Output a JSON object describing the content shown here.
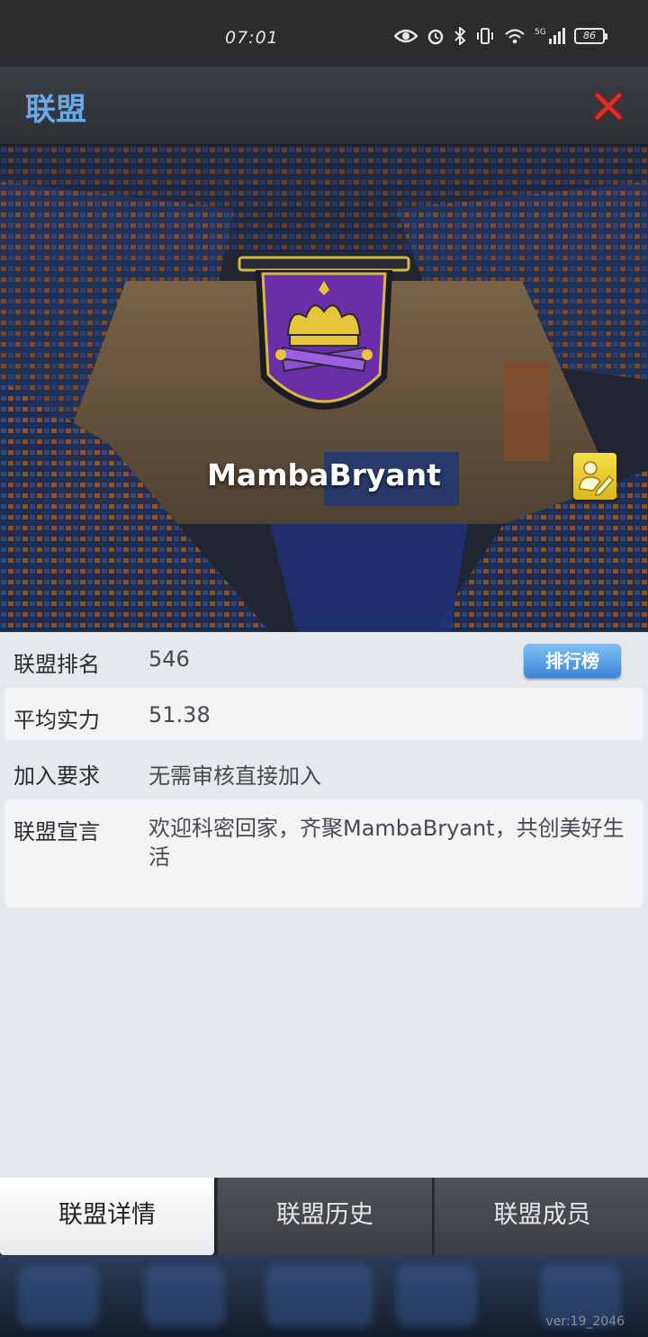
{
  "status_bar": {
    "time": "07:01",
    "battery": "86",
    "network": "5G",
    "icons": [
      "eye-icon",
      "alarm-icon",
      "bluetooth-icon",
      "vibrate-icon",
      "wifi-icon",
      "signal-icon",
      "battery-icon"
    ]
  },
  "header": {
    "title": "联盟",
    "close_icon": "close-icon"
  },
  "alliance": {
    "name": "MambaBryant",
    "emblem_icon": "crown-banner-emblem",
    "edit_icon": "edit-icon"
  },
  "info": {
    "rank_label": "联盟排名",
    "rank_value": "546",
    "rank_button": "排行榜",
    "power_label": "平均实力",
    "power_value": "51.38",
    "join_label": "加入要求",
    "join_value": "无需审核直接加入",
    "declaration_label": "联盟宣言",
    "declaration_value": "欢迎科密回家，齐聚MambaBryant，共创美好生活"
  },
  "tabs": [
    {
      "label": "联盟详情",
      "active": true
    },
    {
      "label": "联盟历史",
      "active": false
    },
    {
      "label": "联盟成员",
      "active": false
    }
  ],
  "version": "ver:19_2046",
  "colors": {
    "title_blue": "#6aa7e6",
    "close_red": "#d8322a",
    "edit_yellow": "#f0d334",
    "emblem_purple": "#6a2fa8",
    "emblem_gold": "#e7c53a"
  }
}
